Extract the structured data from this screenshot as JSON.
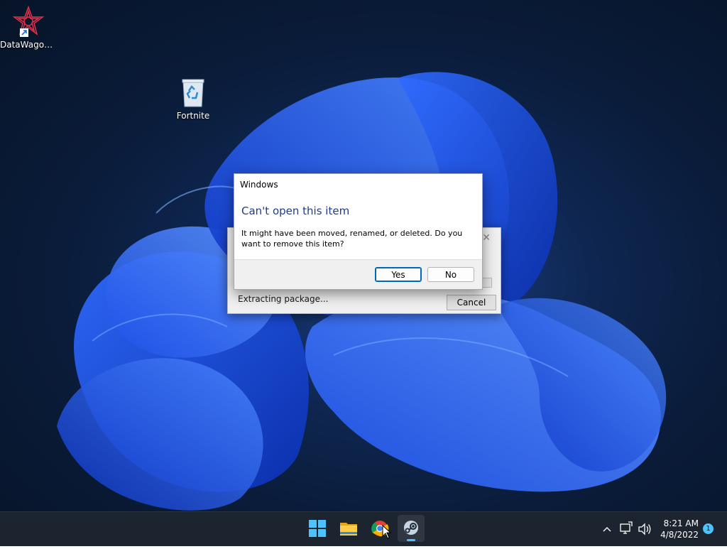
{
  "desktop": {
    "icons": [
      {
        "label": "DataWagon...",
        "icon": "datawagon-shortcut-icon"
      },
      {
        "label": "Fortnite",
        "icon": "recycle-bin-icon"
      }
    ]
  },
  "extract_dialog": {
    "status": "Extracting package...",
    "cancel_label": "Cancel",
    "close_glyph": "✕",
    "progress": 0
  },
  "message_box": {
    "title": "Windows",
    "heading": "Can't open this item",
    "body": "It might have been moved, renamed, or deleted. Do you want to remove this item?",
    "yes_label": "Yes",
    "no_label": "No"
  },
  "taskbar": {
    "apps": [
      {
        "name": "Start",
        "icon": "windows-start-icon"
      },
      {
        "name": "File Explorer",
        "icon": "file-explorer-icon"
      },
      {
        "name": "Google Chrome",
        "icon": "chrome-icon"
      },
      {
        "name": "Steam",
        "icon": "steam-icon",
        "active": true
      }
    ],
    "tray": {
      "time": "8:21 AM",
      "date": "4/8/2022",
      "notification_count": "1"
    }
  },
  "colors": {
    "accent": "#0067c0",
    "heading": "#1c3d8c",
    "indicator": "#4cc2ff",
    "taskbar": "#1c2430"
  }
}
